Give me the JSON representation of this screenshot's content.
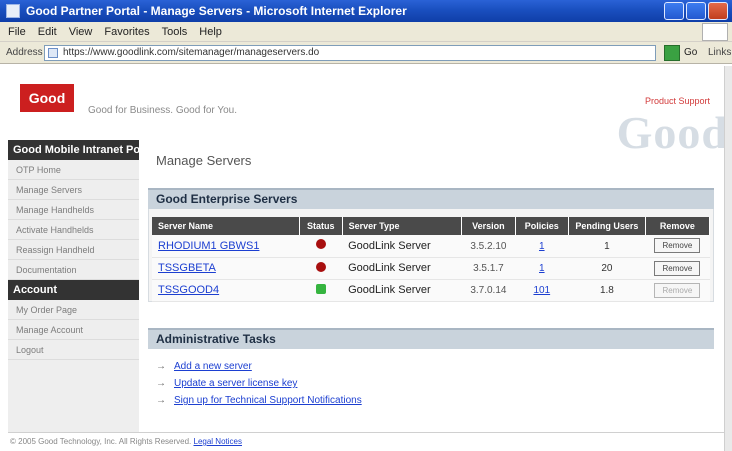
{
  "window": {
    "title": "Good Partner Portal - Manage Servers - Microsoft Internet Explorer"
  },
  "menubar": [
    "File",
    "Edit",
    "View",
    "Favorites",
    "Tools",
    "Help"
  ],
  "addressbar": {
    "label": "Address",
    "url": "https://www.goodlink.com/sitemanager/manageservers.do",
    "go_label": "Go",
    "links_label": "Links"
  },
  "header": {
    "logo": "Good",
    "tagline": "Good for Business. Good for You.",
    "link": "Product Support",
    "brand": "Good"
  },
  "sidebar": {
    "section1_title": "Good Mobile Intranet Portal",
    "section1_items": [
      "OTP Home",
      "Manage Servers",
      "Manage Handhelds",
      "Activate Handhelds",
      "Reassign Handheld",
      "Documentation"
    ],
    "section2_title": "Account",
    "section2_items": [
      "My Order Page",
      "Manage Account",
      "Logout"
    ]
  },
  "main": {
    "page_title": "Manage Servers",
    "servers_panel_title": "Good Enterprise Servers",
    "columns": [
      "Server Name",
      "Status",
      "Server Type",
      "Version",
      "Policies",
      "Pending Users",
      "Remove"
    ],
    "rows": [
      {
        "name": "RHODIUM1 GBWS1",
        "status": "red",
        "type": "GoodLink Server",
        "version": "3.5.2.10",
        "policies": "1",
        "pending": "1",
        "remove": "Remove",
        "remove_enabled": true
      },
      {
        "name": "TSSGBETA",
        "status": "red",
        "type": "GoodLink Server",
        "version": "3.5.1.7",
        "policies": "1",
        "pending": "20",
        "remove": "Remove",
        "remove_enabled": true
      },
      {
        "name": "TSSGOOD4",
        "status": "green",
        "type": "GoodLink Server",
        "version": "3.7.0.14",
        "policies": "101",
        "pending": "1.8",
        "remove": "Remove",
        "remove_enabled": false
      }
    ],
    "admin_panel_title": "Administrative Tasks",
    "tasks": [
      "Add a new server",
      "Update a server license key",
      "Sign up for Technical Support Notifications"
    ]
  },
  "footer": {
    "copyright": "© 2005 Good Technology, Inc. All Rights Reserved.",
    "legal_link": "Legal Notices"
  },
  "colors": {
    "title_bar": "#1a4fbf",
    "logo_red": "#cc1f1f",
    "sidebar_head": "#333333",
    "status_red": "#a80f0f",
    "status_green": "#35b43f",
    "link_blue": "#1c3fd1"
  }
}
